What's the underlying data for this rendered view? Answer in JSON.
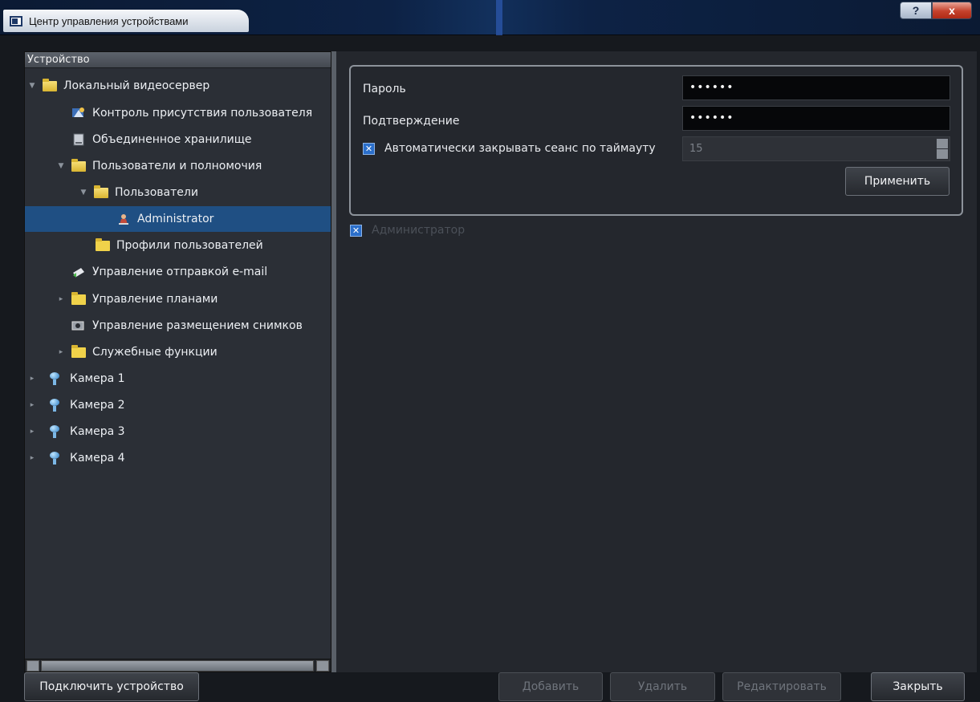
{
  "window": {
    "title": "Центр управления устройствами",
    "help_label": "?",
    "close_label": "x"
  },
  "tree": {
    "header": "Устройство",
    "items": [
      {
        "label": "Локальный видеосервер",
        "icon": "folder-open-icon"
      },
      {
        "label": "Контроль присутствия пользователя",
        "icon": "user-presence-icon"
      },
      {
        "label": "Объединенное хранилище",
        "icon": "storage-icon"
      },
      {
        "label": "Пользователи и полномочия",
        "icon": "folder-open-icon"
      },
      {
        "label": "Пользователи",
        "icon": "folder-open-icon"
      },
      {
        "label": "Administrator",
        "icon": "user-icon"
      },
      {
        "label": "Профили пользователей",
        "icon": "folder-icon"
      },
      {
        "label": "Управление отправкой e-mail",
        "icon": "email-icon"
      },
      {
        "label": "Управление планами",
        "icon": "folder-icon"
      },
      {
        "label": "Управление размещением снимков",
        "icon": "snapshot-icon"
      },
      {
        "label": "Служебные функции",
        "icon": "folder-icon"
      },
      {
        "label": "Камера 1",
        "icon": "camera-icon"
      },
      {
        "label": "Камера 2",
        "icon": "camera-icon"
      },
      {
        "label": "Камера 3",
        "icon": "camera-icon"
      },
      {
        "label": "Камера 4",
        "icon": "camera-icon"
      }
    ]
  },
  "settings": {
    "password_label": "Пароль",
    "password_value": "••••••",
    "confirm_label": "Подтверждение",
    "confirm_value": "••••••",
    "auto_logout_label": "Автоматически закрывать сеанс по таймауту",
    "auto_logout_checked": true,
    "timeout_value": "15",
    "apply_label": "Применить",
    "admin_label": "Администратор",
    "admin_checked": true
  },
  "footer": {
    "connect_label": "Подключить устройство",
    "add_label": "Добавить",
    "delete_label": "Удалить",
    "edit_label": "Редактировать",
    "close_label": "Закрыть"
  },
  "colors": {
    "selection": "#1f4f83",
    "checkbox": "#2b6fcb",
    "panel": "#24272d"
  }
}
